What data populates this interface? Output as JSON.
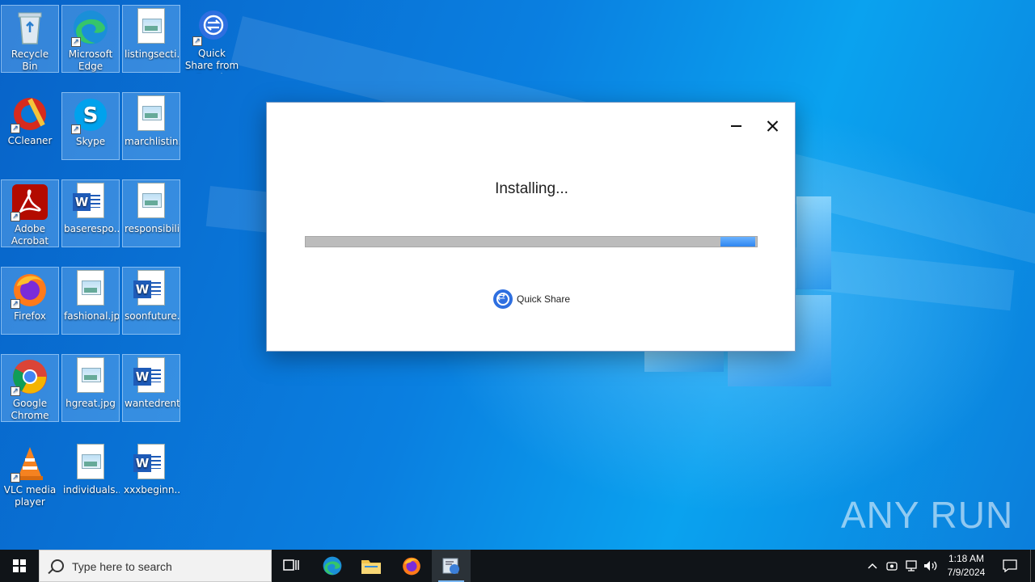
{
  "desktop": {
    "icons": [
      {
        "label": "Recycle Bin"
      },
      {
        "label": "Microsoft Edge"
      },
      {
        "label": "listingsecti..."
      },
      {
        "label": "Quick Share from Google"
      },
      {
        "label": "CCleaner"
      },
      {
        "label": "Skype"
      },
      {
        "label": "marchlistin..."
      },
      {
        "label": "Adobe Acrobat"
      },
      {
        "label": "baserespo..."
      },
      {
        "label": "responsibili..."
      },
      {
        "label": "Firefox"
      },
      {
        "label": "fashional.jpg"
      },
      {
        "label": "soonfuture..."
      },
      {
        "label": "Google Chrome"
      },
      {
        "label": "hgreat.jpg"
      },
      {
        "label": "wantedrent..."
      },
      {
        "label": "VLC media player"
      },
      {
        "label": "individuals..."
      },
      {
        "label": "xxxbeginn..."
      }
    ]
  },
  "dialog": {
    "status": "Installing...",
    "progress_fraction": 0.92,
    "brand_name": "Quick Share"
  },
  "watermark": "ANY RUN",
  "taskbar": {
    "search_placeholder": "Type here to search",
    "apps": [
      "task-view",
      "edge",
      "file-explorer",
      "firefox",
      "installer"
    ],
    "tray": {
      "time": "1:18 AM",
      "date": "7/9/2024"
    }
  }
}
